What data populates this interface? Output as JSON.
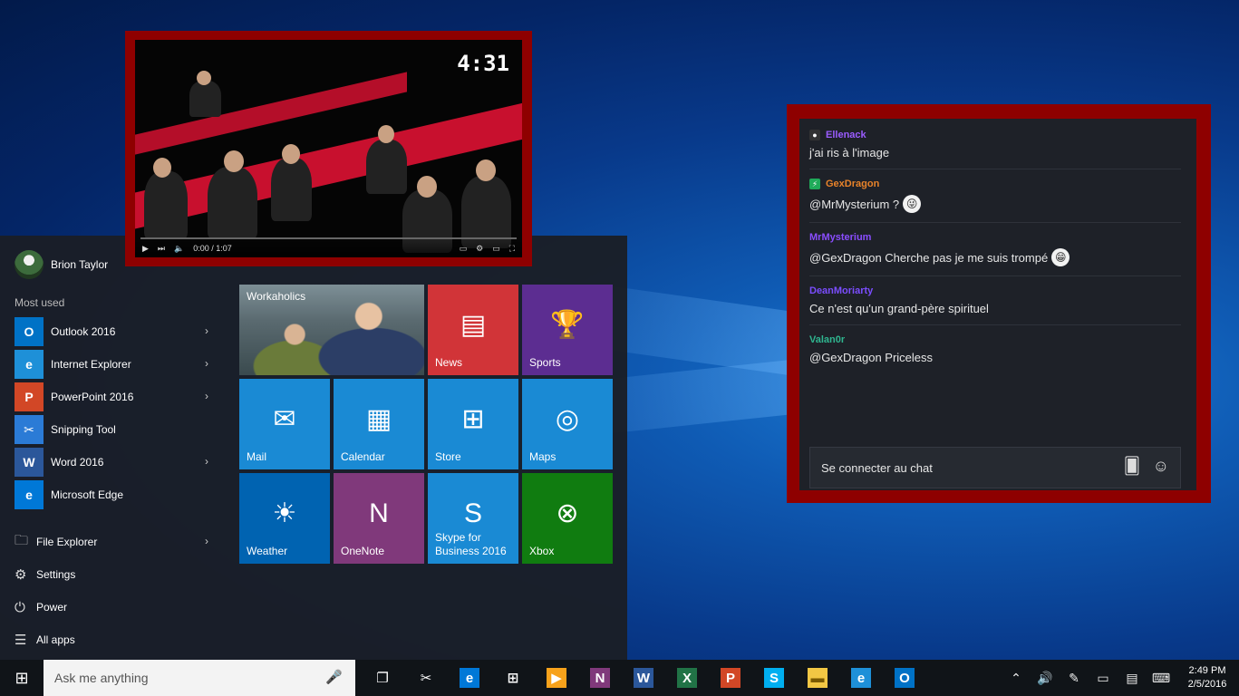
{
  "start_menu": {
    "user_name": "Brion Taylor",
    "most_used_label": "Most used",
    "apps": [
      {
        "label": "Outlook 2016",
        "icon": "outlook-icon",
        "icon_text": "O",
        "color": "#0072c6",
        "has_chevron": true
      },
      {
        "label": "Internet Explorer",
        "icon": "internet-explorer-icon",
        "icon_text": "e",
        "color": "#1e90d8",
        "has_chevron": true
      },
      {
        "label": "PowerPoint 2016",
        "icon": "powerpoint-icon",
        "icon_text": "P",
        "color": "#d24726",
        "has_chevron": true
      },
      {
        "label": "Snipping Tool",
        "icon": "snipping-tool-icon",
        "icon_text": "✂",
        "color": "#2b7bd6",
        "has_chevron": false
      },
      {
        "label": "Word 2016",
        "icon": "word-icon",
        "icon_text": "W",
        "color": "#2b579a",
        "has_chevron": true
      },
      {
        "label": "Microsoft Edge",
        "icon": "edge-icon",
        "icon_text": "e",
        "color": "#0078d7",
        "has_chevron": false
      }
    ],
    "system": [
      {
        "label": "File Explorer",
        "icon": "file-explorer-icon",
        "glyph": "🗀",
        "has_chevron": true
      },
      {
        "label": "Settings",
        "icon": "gear-icon",
        "glyph": "⚙",
        "has_chevron": false
      },
      {
        "label": "Power",
        "icon": "power-icon",
        "glyph": "⏻",
        "has_chevron": false
      },
      {
        "label": "All apps",
        "icon": "all-apps-icon",
        "glyph": "☰",
        "has_chevron": false
      }
    ],
    "tiles": [
      {
        "label": "Workaholics",
        "icon": "workaholics-tile-image",
        "glyph": "",
        "color": "#5a6a70",
        "wide": true,
        "col": 0,
        "row": 0
      },
      {
        "label": "News",
        "icon": "news-icon",
        "glyph": "▤",
        "color": "#d13438",
        "wide": false,
        "col": 2,
        "row": 0
      },
      {
        "label": "Sports",
        "icon": "trophy-icon",
        "glyph": "🏆",
        "color": "#5c2d91",
        "wide": false,
        "col": 3,
        "row": 0
      },
      {
        "label": "Mail",
        "icon": "mail-icon",
        "glyph": "✉",
        "color": "#1a8ad4",
        "wide": false,
        "col": 0,
        "row": 1
      },
      {
        "label": "Calendar",
        "icon": "calendar-icon",
        "glyph": "▦",
        "color": "#1a8ad4",
        "wide": false,
        "col": 1,
        "row": 1
      },
      {
        "label": "Store",
        "icon": "store-icon",
        "glyph": "⊞",
        "color": "#1a8ad4",
        "wide": false,
        "col": 2,
        "row": 1
      },
      {
        "label": "Maps",
        "icon": "maps-icon",
        "glyph": "◎",
        "color": "#1a8ad4",
        "wide": false,
        "col": 3,
        "row": 1
      },
      {
        "label": "Weather",
        "icon": "sun-icon",
        "glyph": "☀",
        "color": "#0063b1",
        "wide": false,
        "col": 0,
        "row": 2
      },
      {
        "label": "OneNote",
        "icon": "onenote-icon",
        "glyph": "N",
        "color": "#80397b",
        "wide": false,
        "col": 1,
        "row": 2
      },
      {
        "label": "Skype for Business 2016",
        "icon": "skype-icon",
        "glyph": "S",
        "color": "#1a8ad4",
        "wide": false,
        "col": 2,
        "row": 2
      },
      {
        "label": "Xbox",
        "icon": "xbox-icon",
        "glyph": "⊗",
        "color": "#107c10",
        "wide": false,
        "col": 3,
        "row": 2
      }
    ]
  },
  "video": {
    "timer": "4:31",
    "time": "0:00 / 1:07",
    "played_fraction": 0.0
  },
  "chat": {
    "messages": [
      {
        "user": "Ellenack",
        "color": "#9b5cff",
        "badge": "●",
        "badge_bg": "#333",
        "text": "j'ai ris à l'image",
        "emote": ""
      },
      {
        "user": "GexDragon",
        "color": "#e8832a",
        "badge": "⚡",
        "badge_bg": "#1faa59",
        "text": "@MrMysterium ?",
        "emote": "😜"
      },
      {
        "user": "MrMysterium",
        "color": "#8a4dff",
        "badge": "",
        "badge_bg": "",
        "text": "@GexDragon Cherche pas je me suis trompé",
        "emote": "😁"
      },
      {
        "user": "DeanMoriarty",
        "color": "#7b4dff",
        "badge": "",
        "badge_bg": "",
        "text": "Ce n'est qu'un grand-père spirituel",
        "emote": ""
      },
      {
        "user": "Valan0r",
        "color": "#2fb58f",
        "badge": "",
        "badge_bg": "",
        "text": "@GexDragon Priceless",
        "emote": ""
      }
    ],
    "input_text": "Se connecter au chat"
  },
  "taskbar": {
    "search_placeholder": "Ask me anything",
    "apps": [
      {
        "icon": "task-view-icon",
        "text": "❐",
        "color": "#101418"
      },
      {
        "icon": "snipping-tool-icon",
        "text": "✂",
        "color": "#101418"
      },
      {
        "icon": "edge-icon",
        "text": "e",
        "color": "#0078d7"
      },
      {
        "icon": "store-icon",
        "text": "⊞",
        "color": "#101418"
      },
      {
        "icon": "media-player-icon",
        "text": "▶",
        "color": "#f7a21b"
      },
      {
        "icon": "onenote-icon",
        "text": "N",
        "color": "#80397b"
      },
      {
        "icon": "word-icon",
        "text": "W",
        "color": "#2b579a"
      },
      {
        "icon": "excel-icon",
        "text": "X",
        "color": "#217346"
      },
      {
        "icon": "powerpoint-icon",
        "text": "P",
        "color": "#d24726"
      },
      {
        "icon": "skype-icon",
        "text": "S",
        "color": "#00aff0"
      },
      {
        "icon": "folder-icon",
        "text": "▬",
        "color": "#f2c744"
      },
      {
        "icon": "internet-explorer-icon",
        "text": "e",
        "color": "#1e90d8"
      },
      {
        "icon": "outlook-icon",
        "text": "O",
        "color": "#0072c6"
      }
    ],
    "tray": [
      {
        "icon": "chevron-up-icon",
        "text": "⌃"
      },
      {
        "icon": "volume-icon",
        "text": "🔊"
      },
      {
        "icon": "pen-icon",
        "text": "✎"
      },
      {
        "icon": "battery-icon",
        "text": "▭"
      },
      {
        "icon": "notification-icon",
        "text": "▤"
      },
      {
        "icon": "keyboard-icon",
        "text": "⌨"
      }
    ],
    "time": "2:49 PM",
    "date": "2/5/2016"
  }
}
